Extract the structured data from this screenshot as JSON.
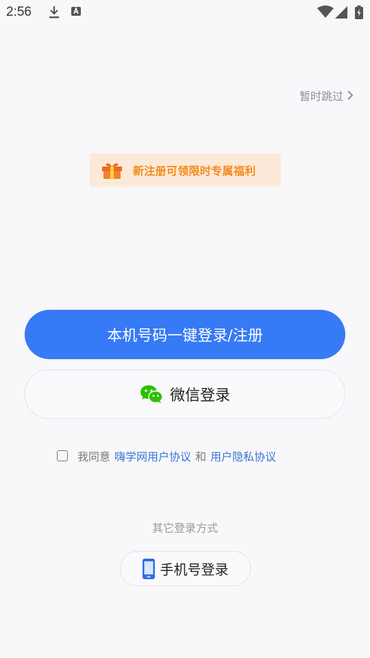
{
  "status_bar": {
    "time": "2:56"
  },
  "skip": {
    "label": "暂时跳过"
  },
  "promo": {
    "text": "新注册可领限时专属福利"
  },
  "one_click_login": {
    "label": "本机号码一键登录/注册"
  },
  "wechat_login": {
    "label": "微信登录"
  },
  "agreement": {
    "prefix": "我同意",
    "user_agreement": "嗨学网用户协议",
    "conjunction": "和",
    "privacy_agreement": "用户隐私协议",
    "checked": false
  },
  "other_methods": {
    "title": "其它登录方式",
    "phone_login": "手机号登录"
  },
  "colors": {
    "primary": "#367af5",
    "link": "#3b73d6",
    "promo_bg": "#fde9d8",
    "promo_text": "#f28a1b",
    "wechat_green": "#2dc100"
  },
  "icons": [
    "download-icon",
    "text-a-icon",
    "wifi-icon",
    "signal-icon",
    "battery-icon",
    "chevron-right-icon",
    "gift-icon",
    "wechat-icon",
    "phone-icon"
  ]
}
